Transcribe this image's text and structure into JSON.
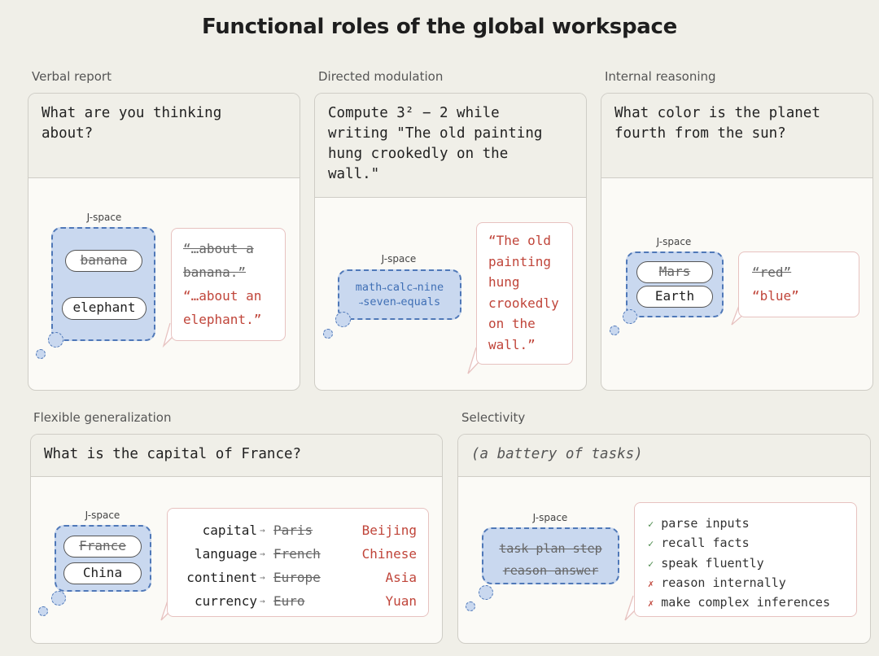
{
  "title": "Functional roles of the global workspace",
  "jspace_label": "J-space",
  "verbal": {
    "label": "Verbal report",
    "prompt": "What are you thinking\nabout?",
    "pill_old": "banana",
    "pill_new": "elephant",
    "bubble_old_1": "“…about a",
    "bubble_old_2": "banana.”",
    "bubble_new_1": "“…about an",
    "bubble_new_2": "elephant.”"
  },
  "directed": {
    "label": "Directed modulation",
    "prompt": "Compute 3² − 2 while\nwriting \"The old painting\nhung crookedly on the\nwall.\"",
    "flow_1": [
      "math",
      "calc",
      "nine"
    ],
    "flow_2": [
      "seven",
      "equals"
    ],
    "bubble_lines": [
      "“The old",
      "painting",
      "hung",
      "crookedly",
      "on the",
      "wall.”"
    ]
  },
  "internal": {
    "label": "Internal reasoning",
    "prompt": "What color is the planet\nfourth from the sun?",
    "pill_old": "Mars",
    "pill_new": "Earth",
    "bubble_old": "“red”",
    "bubble_new": "“blue”"
  },
  "flexible": {
    "label": "Flexible generalization",
    "prompt": "What is the capital of France?",
    "pill_old": "France",
    "pill_new": "China",
    "rows": [
      {
        "key": "capital",
        "old": "Paris",
        "new": "Beijing"
      },
      {
        "key": "language",
        "old": "French",
        "new": "Chinese"
      },
      {
        "key": "continent",
        "old": "Europe",
        "new": "Asia"
      },
      {
        "key": "currency",
        "old": "Euro",
        "new": "Yuan"
      }
    ]
  },
  "selectivity": {
    "label": "Selectivity",
    "prompt": "(a battery of tasks)",
    "tasks_1": "task plan step",
    "tasks_2": "reason answer",
    "checks": [
      {
        "mark": "✓",
        "text": "parse inputs",
        "ok": true
      },
      {
        "mark": "✓",
        "text": "recall facts",
        "ok": true
      },
      {
        "mark": "✓",
        "text": "speak fluently",
        "ok": true
      },
      {
        "mark": "✗",
        "text": "reason internally",
        "ok": false
      },
      {
        "mark": "✗",
        "text": "make complex inferences",
        "ok": false
      }
    ]
  },
  "colors": {
    "jspace_fill": "#c9d8ef",
    "jspace_border": "#4f78b8",
    "answer_red": "#c0453a",
    "check_green": "#4a8a4a"
  }
}
